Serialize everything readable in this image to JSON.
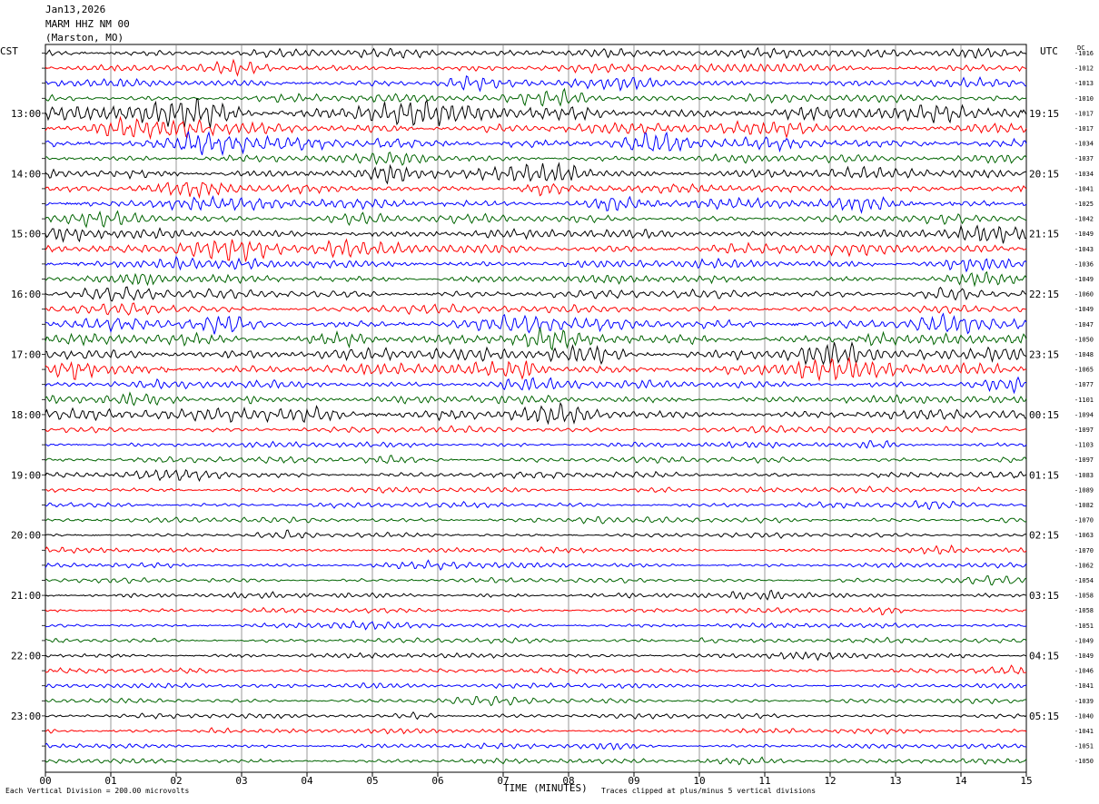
{
  "header": {
    "date": "Jan13,2026",
    "station": "MARM HHZ NM 00",
    "location": "(Marston, MO)"
  },
  "labels": {
    "left_tz": "CST",
    "right_tz": "UTC",
    "dc_header": "DC",
    "x_axis": "TIME (MINUTES)",
    "scale_note": "Each Vertical Division =  200.00 microvolts",
    "clip_note": "Traces clipped at plus/minus 5 vertical divisions"
  },
  "colors": {
    "cycle": [
      "#000000",
      "#ff0000",
      "#0000ff",
      "#006400"
    ],
    "grid": "#7f7f7f"
  },
  "chart_data": {
    "type": "line",
    "x_label": "TIME (MINUTES)",
    "x_ticks": [
      "00",
      "01",
      "02",
      "03",
      "04",
      "05",
      "06",
      "07",
      "08",
      "09",
      "10",
      "11",
      "12",
      "13",
      "14",
      "15"
    ],
    "xlim": [
      0,
      15
    ],
    "rows_per_hour": 4,
    "minutes_per_row": 15,
    "left_hour_labels": [
      "13:00",
      "14:00",
      "15:00",
      "16:00",
      "17:00",
      "18:00",
      "19:00",
      "20:00",
      "21:00",
      "22:00",
      "23:00"
    ],
    "right_hour_labels": [
      "19:15",
      "20:15",
      "21:15",
      "22:15",
      "23:15",
      "00:15",
      "01:15",
      "02:15",
      "03:15",
      "04:15",
      "05:15"
    ],
    "dc_offsets": [
      "-1016",
      "-1012",
      "-1013",
      "-1010",
      "-1017",
      "-1017",
      "-1034",
      "-1037",
      "-1034",
      "-1041",
      "-1025",
      "-1042",
      "-1049",
      "-1043",
      "-1036",
      "-1049",
      "-1060",
      "-1049",
      "-1047",
      "-1050",
      "-1048",
      "-1065",
      "-1077",
      "-1101",
      "-1094",
      "-1097",
      "-1103",
      "-1097",
      "-1083",
      "-1089",
      "-1082",
      "-1070",
      "-1063",
      "-1070",
      "-1062",
      "-1054",
      "-1058",
      "-1058",
      "-1051",
      "-1049",
      "-1049",
      "-1046",
      "-1041",
      "-1039",
      "-1040",
      "-1041",
      "-1051",
      "-1050"
    ],
    "row_activity": [
      1.4,
      1.2,
      1.3,
      1.3,
      2.4,
      1.8,
      1.9,
      1.3,
      1.7,
      1.4,
      1.6,
      1.3,
      1.5,
      1.8,
      1.4,
      1.3,
      1.4,
      1.2,
      1.8,
      1.7,
      2.0,
      2.0,
      1.3,
      1.3,
      1.7,
      1.0,
      0.9,
      1.0,
      1.0,
      0.9,
      0.9,
      0.9,
      0.8,
      0.8,
      0.8,
      0.8,
      0.9,
      0.8,
      0.8,
      0.8,
      0.8,
      0.8,
      0.8,
      0.8,
      0.8,
      0.8,
      0.8,
      0.8
    ]
  }
}
